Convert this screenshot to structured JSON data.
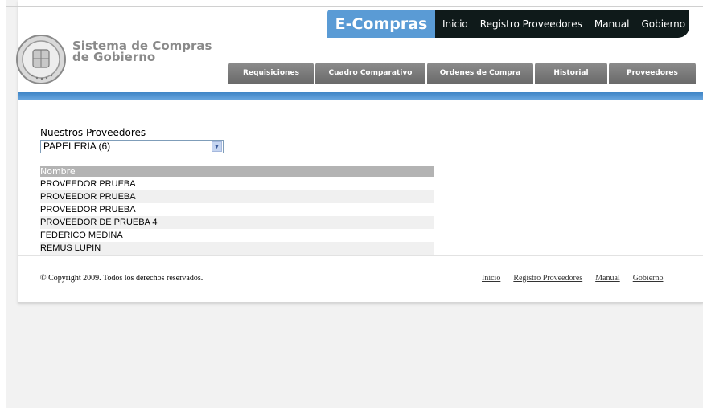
{
  "header": {
    "brand": "E-Compras",
    "nav": [
      "Inicio",
      "Registro Proveedores",
      "Manual",
      "Gobierno"
    ],
    "site_title_line1": "Sistema de Compras",
    "site_title_line2": "de Gobierno",
    "seal_icon": "government-seal-icon"
  },
  "tabs": [
    "Requisiciones",
    "Cuadro Comparativo",
    "Ordenes de Compra",
    "Historial",
    "Proveedores"
  ],
  "main": {
    "label": "Nuestros Proveedores",
    "select_value": "PAPELERIA (6)",
    "table_header": "Nombre",
    "rows": [
      "PROVEEDOR PRUEBA",
      "PROVEEDOR PRUEBA",
      "PROVEEDOR PRUEBA",
      "PROVEEDOR DE PRUEBA 4",
      "FEDERICO MEDINA",
      "REMUS LUPIN"
    ]
  },
  "footer": {
    "copyright": "© Copyright 2009. Todos los derechos reservados.",
    "links": [
      "Inicio",
      "Registro Proveedores",
      "Manual",
      "Gobierno"
    ]
  },
  "colors": {
    "accent": "#5a9bd5",
    "nav_bg": "#0f1a1a",
    "tab_bg": "#7a7a7a",
    "bar": "#4a8fd0"
  }
}
